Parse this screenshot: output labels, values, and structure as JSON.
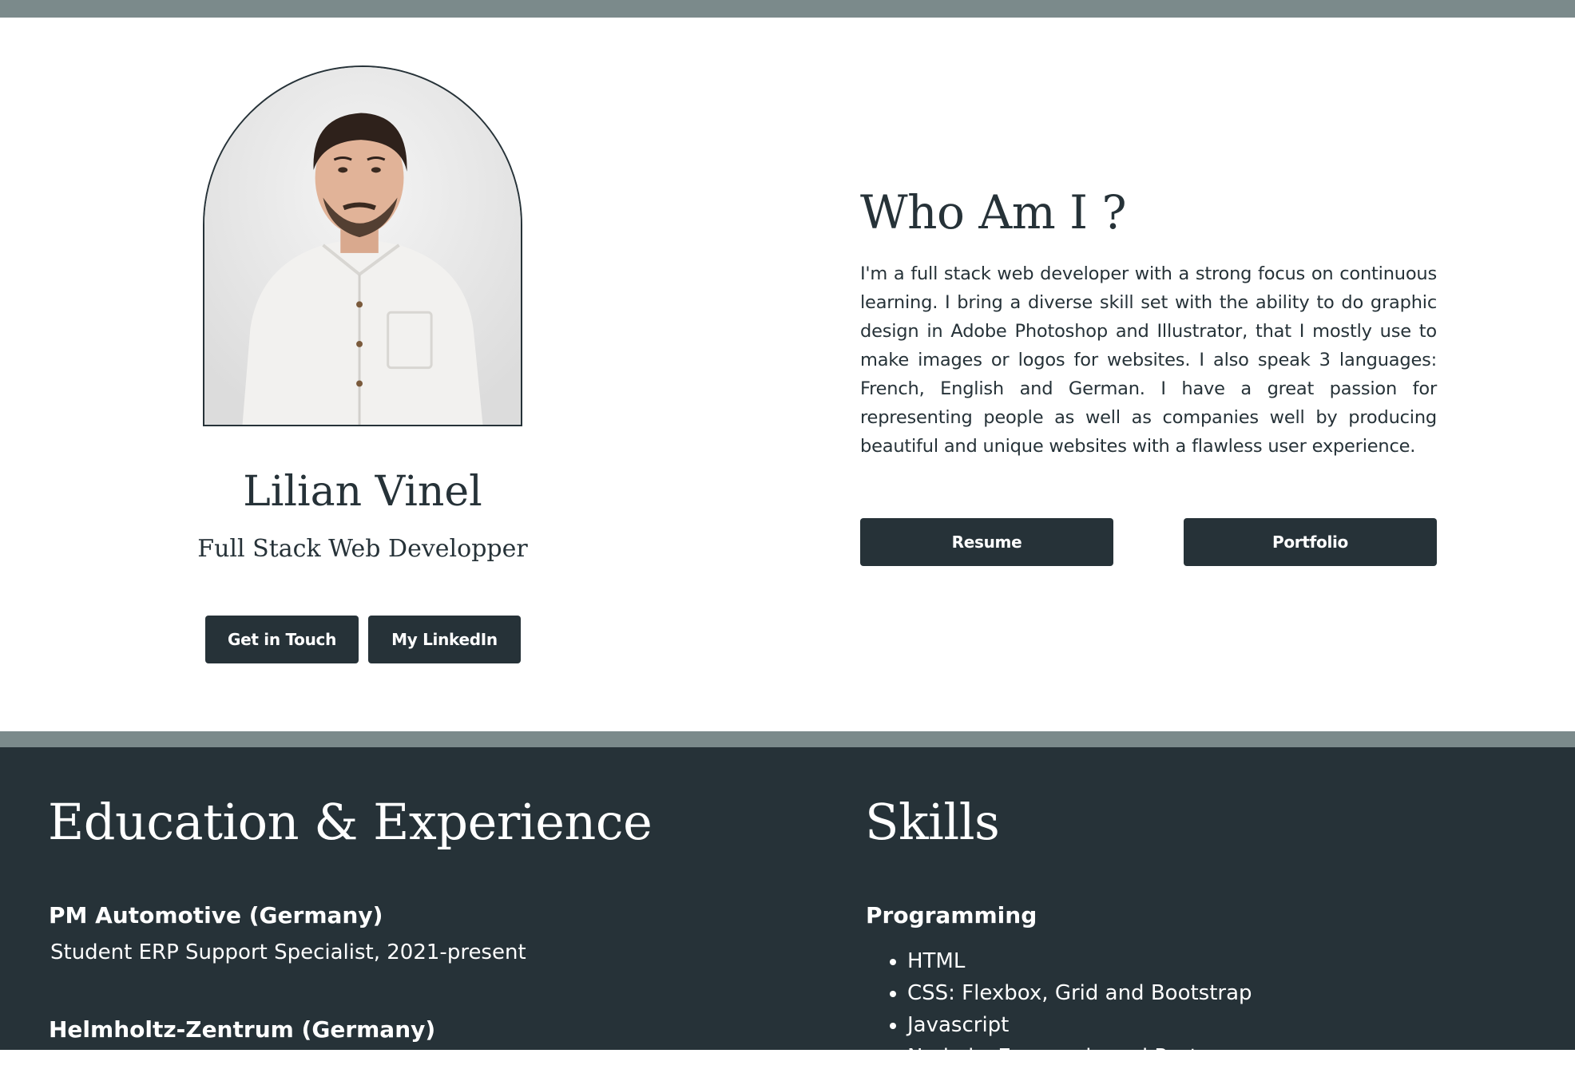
{
  "profile": {
    "photo_alt": "portrait",
    "name": "Lilian Vinel",
    "title": "Full Stack Web Developper",
    "buttons": {
      "contact": "Get in Touch",
      "linkedin": "My LinkedIn"
    }
  },
  "about": {
    "heading": "Who Am I ?",
    "text": "I'm a full stack web developer with a strong focus on continuous learning. I bring a diverse skill set with the ability to do graphic design in Adobe Photoshop and Illustrator, that I mostly use to make images or logos for websites. I also speak 3 languages: French, English and German. I have a great passion for representing people as well as companies well by producing beautiful and unique websites with a flawless user experience.",
    "buttons": {
      "resume": "Resume",
      "portfolio": "Portfolio"
    }
  },
  "education": {
    "heading": "Education & Experience",
    "entries": [
      {
        "title": "PM Automotive (Germany)",
        "subtitle": "Student ERP Support Specialist, 2021-present"
      },
      {
        "title": "Helmholtz-Zentrum (Germany)"
      }
    ]
  },
  "skills": {
    "heading": "Skills",
    "categories": [
      {
        "name": "Programming",
        "items": [
          "HTML",
          "CSS: Flexbox, Grid and Bootstrap",
          "Javascript",
          "Node.js, Express.js and Postgres"
        ]
      }
    ]
  },
  "colors": {
    "dark": "#263238",
    "bar": "#7b8a8b",
    "background": "#ffffff"
  }
}
